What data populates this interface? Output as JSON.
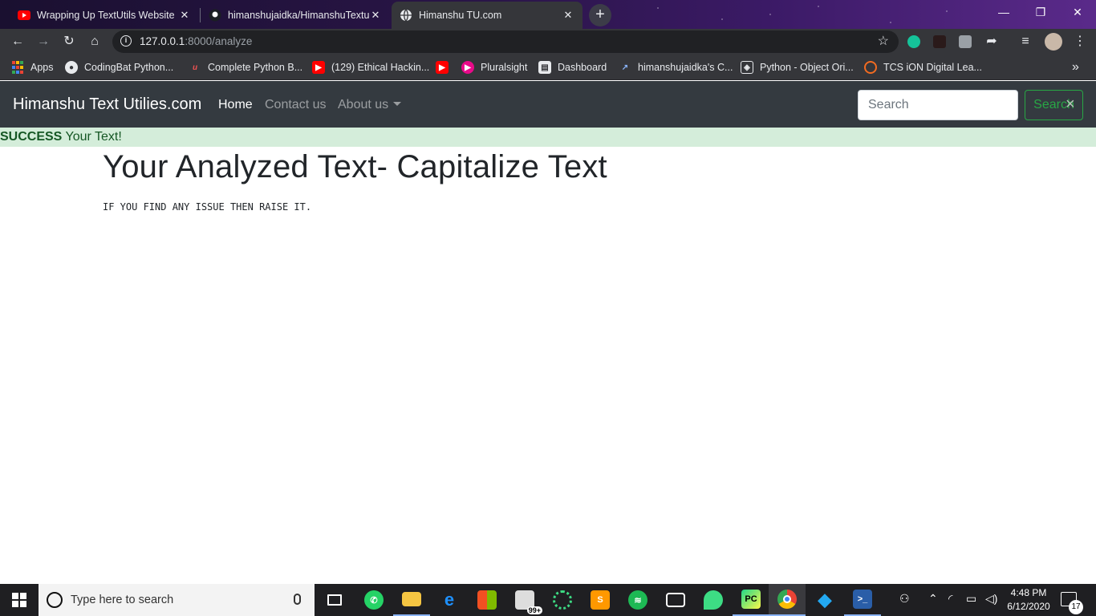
{
  "browser": {
    "tabs": [
      {
        "title": "Wrapping Up TextUtils Website |",
        "favicon": "youtube-icon",
        "active": false
      },
      {
        "title": "himanshujaidka/HimanshuTextutils",
        "favicon": "github-icon",
        "active": false
      },
      {
        "title": "Himanshu TU.com",
        "favicon": "globe-icon",
        "active": true
      }
    ],
    "new_tab": "+",
    "address": {
      "host": "127.0.0.1",
      "path": ":8000/analyze"
    },
    "bookmarks": [
      {
        "label": "Apps",
        "icon": "apps-grid-icon"
      },
      {
        "label": "CodingBat Python...",
        "icon": "globe-icon"
      },
      {
        "label": "Complete Python B...",
        "icon": "udemy-icon"
      },
      {
        "label": "(129) Ethical Hackin...",
        "icon": "youtube-icon"
      },
      {
        "label": "",
        "icon": "youtube-icon"
      },
      {
        "label": "Pluralsight",
        "icon": "pluralsight-icon"
      },
      {
        "label": "Dashboard",
        "icon": "dashboard-icon"
      },
      {
        "label": "himanshujaidka's C...",
        "icon": "codepen-icon"
      },
      {
        "label": "Python - Object Ori...",
        "icon": "hackerrank-icon"
      },
      {
        "label": "TCS iON Digital Lea...",
        "icon": "tcs-icon"
      }
    ],
    "bookmarks_overflow": "»"
  },
  "page": {
    "brand": "Himanshu Text Utilies.com",
    "nav": {
      "home": "Home",
      "contact": "Contact us",
      "about": "About us"
    },
    "search": {
      "placeholder": "Search",
      "button": "Search"
    },
    "alert": {
      "strong": "SUCCESS",
      "message": "Your Text!",
      "close": "×"
    },
    "heading": "Your Analyzed Text- Capitalize Text",
    "result": "IF YOU FIND ANY ISSUE THEN RAISE IT."
  },
  "taskbar": {
    "search_placeholder": "Type here to search",
    "mail_badge": "99+",
    "time": "4:48 PM",
    "date": "6/12/2020",
    "notifications": "17"
  },
  "colors": {
    "navbar": "#343a40",
    "alert_bg": "#d4edda",
    "alert_text": "#155724",
    "search_btn": "#28a745"
  }
}
